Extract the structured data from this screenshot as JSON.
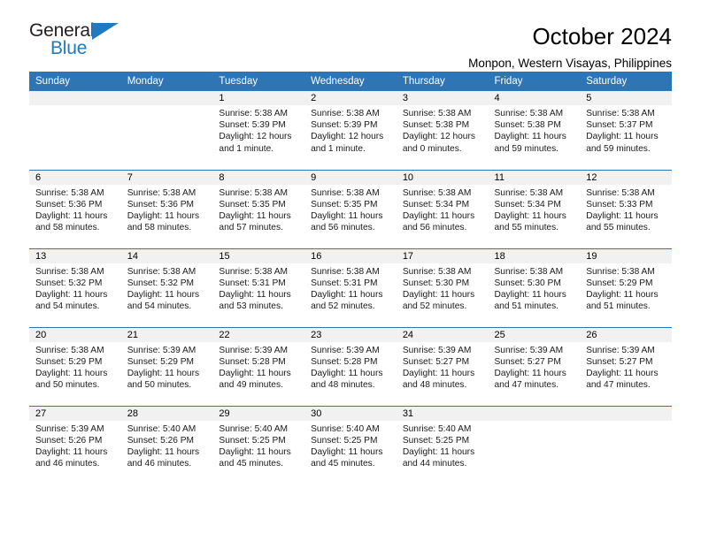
{
  "logo": {
    "word_one": "General",
    "word_two": "Blue",
    "triangle_color": "#1f7ac0"
  },
  "header": {
    "title": "October 2024",
    "subtitle": "Monpon, Western Visayas, Philippines"
  },
  "theme": {
    "header_blue": "#2e75b6",
    "daynum_band": "#f1f1f1",
    "text": "#000000"
  },
  "weekdays": [
    "Sunday",
    "Monday",
    "Tuesday",
    "Wednesday",
    "Thursday",
    "Friday",
    "Saturday"
  ],
  "labels": {
    "sunrise_prefix": "Sunrise:",
    "sunset_prefix": "Sunset:",
    "daylight_prefix": "Daylight:"
  },
  "weeks": [
    [
      {
        "day": "",
        "sunrise": "",
        "sunset": "",
        "daylight_line1": "",
        "daylight_line2": ""
      },
      {
        "day": "",
        "sunrise": "",
        "sunset": "",
        "daylight_line1": "",
        "daylight_line2": ""
      },
      {
        "day": "1",
        "sunrise": "Sunrise: 5:38 AM",
        "sunset": "Sunset: 5:39 PM",
        "daylight_line1": "Daylight: 12 hours",
        "daylight_line2": "and 1 minute."
      },
      {
        "day": "2",
        "sunrise": "Sunrise: 5:38 AM",
        "sunset": "Sunset: 5:39 PM",
        "daylight_line1": "Daylight: 12 hours",
        "daylight_line2": "and 1 minute."
      },
      {
        "day": "3",
        "sunrise": "Sunrise: 5:38 AM",
        "sunset": "Sunset: 5:38 PM",
        "daylight_line1": "Daylight: 12 hours",
        "daylight_line2": "and 0 minutes."
      },
      {
        "day": "4",
        "sunrise": "Sunrise: 5:38 AM",
        "sunset": "Sunset: 5:38 PM",
        "daylight_line1": "Daylight: 11 hours",
        "daylight_line2": "and 59 minutes."
      },
      {
        "day": "5",
        "sunrise": "Sunrise: 5:38 AM",
        "sunset": "Sunset: 5:37 PM",
        "daylight_line1": "Daylight: 11 hours",
        "daylight_line2": "and 59 minutes."
      }
    ],
    [
      {
        "day": "6",
        "sunrise": "Sunrise: 5:38 AM",
        "sunset": "Sunset: 5:36 PM",
        "daylight_line1": "Daylight: 11 hours",
        "daylight_line2": "and 58 minutes."
      },
      {
        "day": "7",
        "sunrise": "Sunrise: 5:38 AM",
        "sunset": "Sunset: 5:36 PM",
        "daylight_line1": "Daylight: 11 hours",
        "daylight_line2": "and 58 minutes."
      },
      {
        "day": "8",
        "sunrise": "Sunrise: 5:38 AM",
        "sunset": "Sunset: 5:35 PM",
        "daylight_line1": "Daylight: 11 hours",
        "daylight_line2": "and 57 minutes."
      },
      {
        "day": "9",
        "sunrise": "Sunrise: 5:38 AM",
        "sunset": "Sunset: 5:35 PM",
        "daylight_line1": "Daylight: 11 hours",
        "daylight_line2": "and 56 minutes."
      },
      {
        "day": "10",
        "sunrise": "Sunrise: 5:38 AM",
        "sunset": "Sunset: 5:34 PM",
        "daylight_line1": "Daylight: 11 hours",
        "daylight_line2": "and 56 minutes."
      },
      {
        "day": "11",
        "sunrise": "Sunrise: 5:38 AM",
        "sunset": "Sunset: 5:34 PM",
        "daylight_line1": "Daylight: 11 hours",
        "daylight_line2": "and 55 minutes."
      },
      {
        "day": "12",
        "sunrise": "Sunrise: 5:38 AM",
        "sunset": "Sunset: 5:33 PM",
        "daylight_line1": "Daylight: 11 hours",
        "daylight_line2": "and 55 minutes."
      }
    ],
    [
      {
        "day": "13",
        "sunrise": "Sunrise: 5:38 AM",
        "sunset": "Sunset: 5:32 PM",
        "daylight_line1": "Daylight: 11 hours",
        "daylight_line2": "and 54 minutes."
      },
      {
        "day": "14",
        "sunrise": "Sunrise: 5:38 AM",
        "sunset": "Sunset: 5:32 PM",
        "daylight_line1": "Daylight: 11 hours",
        "daylight_line2": "and 54 minutes."
      },
      {
        "day": "15",
        "sunrise": "Sunrise: 5:38 AM",
        "sunset": "Sunset: 5:31 PM",
        "daylight_line1": "Daylight: 11 hours",
        "daylight_line2": "and 53 minutes."
      },
      {
        "day": "16",
        "sunrise": "Sunrise: 5:38 AM",
        "sunset": "Sunset: 5:31 PM",
        "daylight_line1": "Daylight: 11 hours",
        "daylight_line2": "and 52 minutes."
      },
      {
        "day": "17",
        "sunrise": "Sunrise: 5:38 AM",
        "sunset": "Sunset: 5:30 PM",
        "daylight_line1": "Daylight: 11 hours",
        "daylight_line2": "and 52 minutes."
      },
      {
        "day": "18",
        "sunrise": "Sunrise: 5:38 AM",
        "sunset": "Sunset: 5:30 PM",
        "daylight_line1": "Daylight: 11 hours",
        "daylight_line2": "and 51 minutes."
      },
      {
        "day": "19",
        "sunrise": "Sunrise: 5:38 AM",
        "sunset": "Sunset: 5:29 PM",
        "daylight_line1": "Daylight: 11 hours",
        "daylight_line2": "and 51 minutes."
      }
    ],
    [
      {
        "day": "20",
        "sunrise": "Sunrise: 5:38 AM",
        "sunset": "Sunset: 5:29 PM",
        "daylight_line1": "Daylight: 11 hours",
        "daylight_line2": "and 50 minutes."
      },
      {
        "day": "21",
        "sunrise": "Sunrise: 5:39 AM",
        "sunset": "Sunset: 5:29 PM",
        "daylight_line1": "Daylight: 11 hours",
        "daylight_line2": "and 50 minutes."
      },
      {
        "day": "22",
        "sunrise": "Sunrise: 5:39 AM",
        "sunset": "Sunset: 5:28 PM",
        "daylight_line1": "Daylight: 11 hours",
        "daylight_line2": "and 49 minutes."
      },
      {
        "day": "23",
        "sunrise": "Sunrise: 5:39 AM",
        "sunset": "Sunset: 5:28 PM",
        "daylight_line1": "Daylight: 11 hours",
        "daylight_line2": "and 48 minutes."
      },
      {
        "day": "24",
        "sunrise": "Sunrise: 5:39 AM",
        "sunset": "Sunset: 5:27 PM",
        "daylight_line1": "Daylight: 11 hours",
        "daylight_line2": "and 48 minutes."
      },
      {
        "day": "25",
        "sunrise": "Sunrise: 5:39 AM",
        "sunset": "Sunset: 5:27 PM",
        "daylight_line1": "Daylight: 11 hours",
        "daylight_line2": "and 47 minutes."
      },
      {
        "day": "26",
        "sunrise": "Sunrise: 5:39 AM",
        "sunset": "Sunset: 5:27 PM",
        "daylight_line1": "Daylight: 11 hours",
        "daylight_line2": "and 47 minutes."
      }
    ],
    [
      {
        "day": "27",
        "sunrise": "Sunrise: 5:39 AM",
        "sunset": "Sunset: 5:26 PM",
        "daylight_line1": "Daylight: 11 hours",
        "daylight_line2": "and 46 minutes."
      },
      {
        "day": "28",
        "sunrise": "Sunrise: 5:40 AM",
        "sunset": "Sunset: 5:26 PM",
        "daylight_line1": "Daylight: 11 hours",
        "daylight_line2": "and 46 minutes."
      },
      {
        "day": "29",
        "sunrise": "Sunrise: 5:40 AM",
        "sunset": "Sunset: 5:25 PM",
        "daylight_line1": "Daylight: 11 hours",
        "daylight_line2": "and 45 minutes."
      },
      {
        "day": "30",
        "sunrise": "Sunrise: 5:40 AM",
        "sunset": "Sunset: 5:25 PM",
        "daylight_line1": "Daylight: 11 hours",
        "daylight_line2": "and 45 minutes."
      },
      {
        "day": "31",
        "sunrise": "Sunrise: 5:40 AM",
        "sunset": "Sunset: 5:25 PM",
        "daylight_line1": "Daylight: 11 hours",
        "daylight_line2": "and 44 minutes."
      },
      {
        "day": "",
        "sunrise": "",
        "sunset": "",
        "daylight_line1": "",
        "daylight_line2": ""
      },
      {
        "day": "",
        "sunrise": "",
        "sunset": "",
        "daylight_line1": "",
        "daylight_line2": ""
      }
    ]
  ]
}
